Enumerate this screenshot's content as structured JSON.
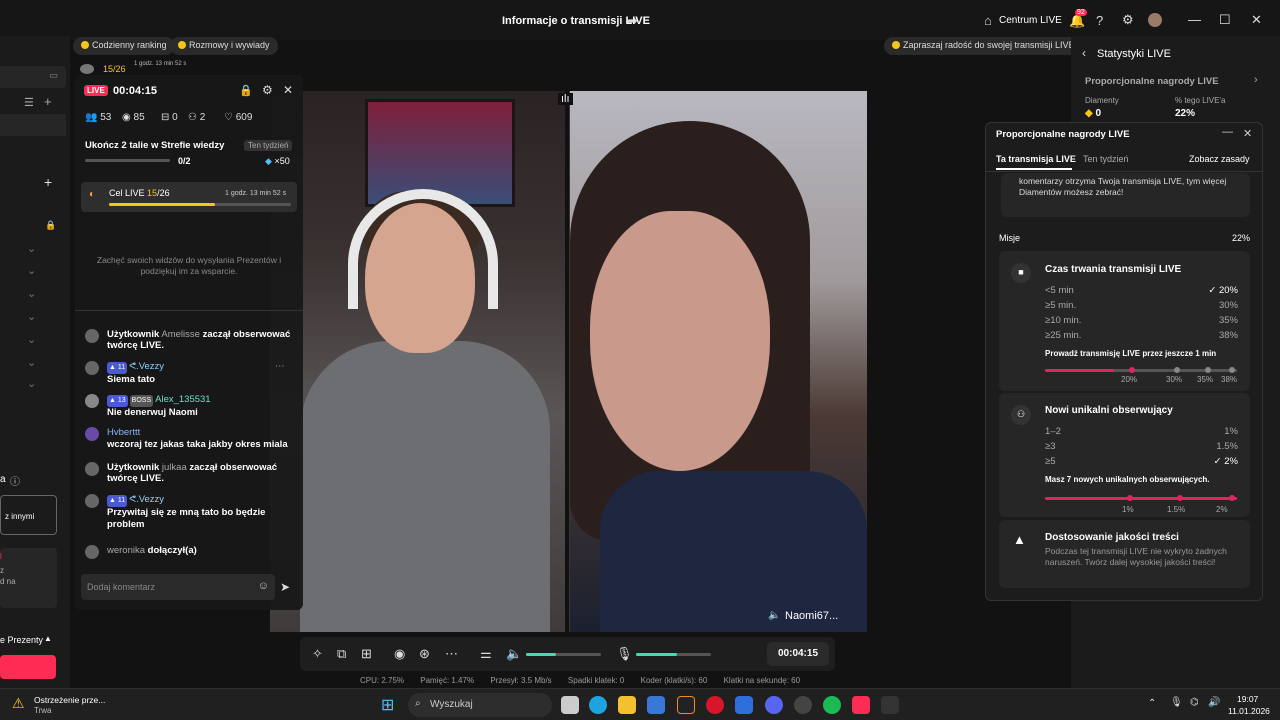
{
  "window": {
    "title": "Informacje o transmisji LIVE",
    "centrum": "Centrum LIVE",
    "notif_count": "92"
  },
  "pills": {
    "ranking": "Codzienny ranking",
    "rozmowy": "Rozmowy i wywiady",
    "zapraszaj": "Zapraszaj radość do swojej transmisji LIVE"
  },
  "chat": {
    "mini_progress": "15/26",
    "mini_time": "1 godz. 13 min 52 s",
    "live_label": "LIVE",
    "duration": "00:04:15",
    "stats": {
      "viewers": "53",
      "views": "85",
      "gifts": "0",
      "members": "2",
      "likes": "609"
    },
    "task": {
      "title": "Ukończ 2 talie w Strefie wiedzy",
      "badge": "Ten tydzień",
      "progress": "0/2",
      "reward": "×50"
    },
    "goal": {
      "label": "Cel LIVE",
      "current": "15",
      "total": "/26",
      "time": "1 godz. 13 min 52 s",
      "fraction": 0.58
    },
    "encourage": "Zachęć swoich widzów do wysyłania Prezentów i podziękuj im za wsparcie.",
    "messages": [
      {
        "user": "Użytkownik",
        "name": "Amelisse",
        "text": "zaczął obserwować twórcę LIVE."
      },
      {
        "level": "11",
        "name": "ᕙ.Vezzy",
        "text": "Siema tato"
      },
      {
        "level": "13",
        "badge": "BOSS",
        "name": "Alex_135531",
        "text": "Nie denerwuj Naomi"
      },
      {
        "name": "Hvberttt",
        "text": "wczoraj tez jakas taka jakby okres miala"
      },
      {
        "user": "Użytkownik",
        "name": "julkaa",
        "text": "zaczął obserwować twórcę LIVE."
      },
      {
        "level": "11",
        "name": "ᕙ.Vezzy",
        "text": "Przywitaj się ze mną tato bo będzie problem"
      },
      {
        "name": "weronika",
        "text": "dołączył(a)"
      }
    ],
    "input_placeholder": "Dodaj komentarz"
  },
  "video": {
    "guest_name": "Naomi67..."
  },
  "controls": {
    "timer": "00:04:15",
    "mic_level": 0.55,
    "volume_level": 0.4,
    "status": {
      "cpu": "CPU: 2.75%",
      "memory": "Pamięć: 1.47%",
      "throughput": "Przesył: 3.5 Mb/s",
      "drops": "Spadki klatek: 0",
      "encoder": "Koder (klatki/s): 60",
      "fps": "Klatki na sekundę: 60"
    }
  },
  "stats_panel": {
    "title": "Statystyki LIVE",
    "section": "Proporcjonalne nagrody LIVE",
    "diamonds_label": "Diamenty",
    "diamonds_value": "0",
    "percent_label": "% tego LIVE'a",
    "percent_value": "22%"
  },
  "reward": {
    "title": "Proporcjonalne nagrody LIVE",
    "tab_active": "Ta transmisja LIVE",
    "tab_week": "Ten tydzień",
    "rules_link": "Zobacz zasady",
    "intro": "komentarzy otrzyma Twoja transmisja LIVE, tym więcej Diamentów możesz zebrać!",
    "missions_label": "Misje",
    "missions_value": "22%",
    "m1": {
      "title": "Czas trwania transmisji LIVE",
      "rows": [
        [
          "<5 min",
          "✓ 20%"
        ],
        [
          "≥5 min.",
          "30%"
        ],
        [
          "≥10 min.",
          "35%"
        ],
        [
          "≥25 min.",
          "38%"
        ]
      ],
      "hint": "Prowadź transmisję LIVE przez jeszcze 1 min",
      "scale": [
        "20%",
        "30%",
        "35%",
        "38%"
      ],
      "progress": 0.36
    },
    "m2": {
      "title": "Nowi unikalni obserwujący",
      "rows": [
        [
          "1–2",
          "1%"
        ],
        [
          "≥3",
          "1.5%"
        ],
        [
          "≥5",
          "✓ 2%"
        ]
      ],
      "hint": "Masz 7 nowych unikalnych obserwujących.",
      "scale": [
        "1%",
        "1.5%",
        "2%"
      ],
      "progress": 1.0
    },
    "m3": {
      "title": "Dostosowanie jakości treści",
      "text": "Podczas tej transmisji LIVE nie wykryto żadnych naruszeń. Twórz dalej wysokiej jakości treści!"
    }
  },
  "leftbar": {
    "heading_a": "a",
    "input_text": "z innymi",
    "line1": "z",
    "line2": "d na",
    "prezenty": "e Prezenty"
  },
  "taskbar": {
    "warning_title": "Ostrzeżenie prze...",
    "warning_sub": "Trwa",
    "search": "Wyszukaj",
    "time": "19:07",
    "date": "11.01.2026"
  }
}
